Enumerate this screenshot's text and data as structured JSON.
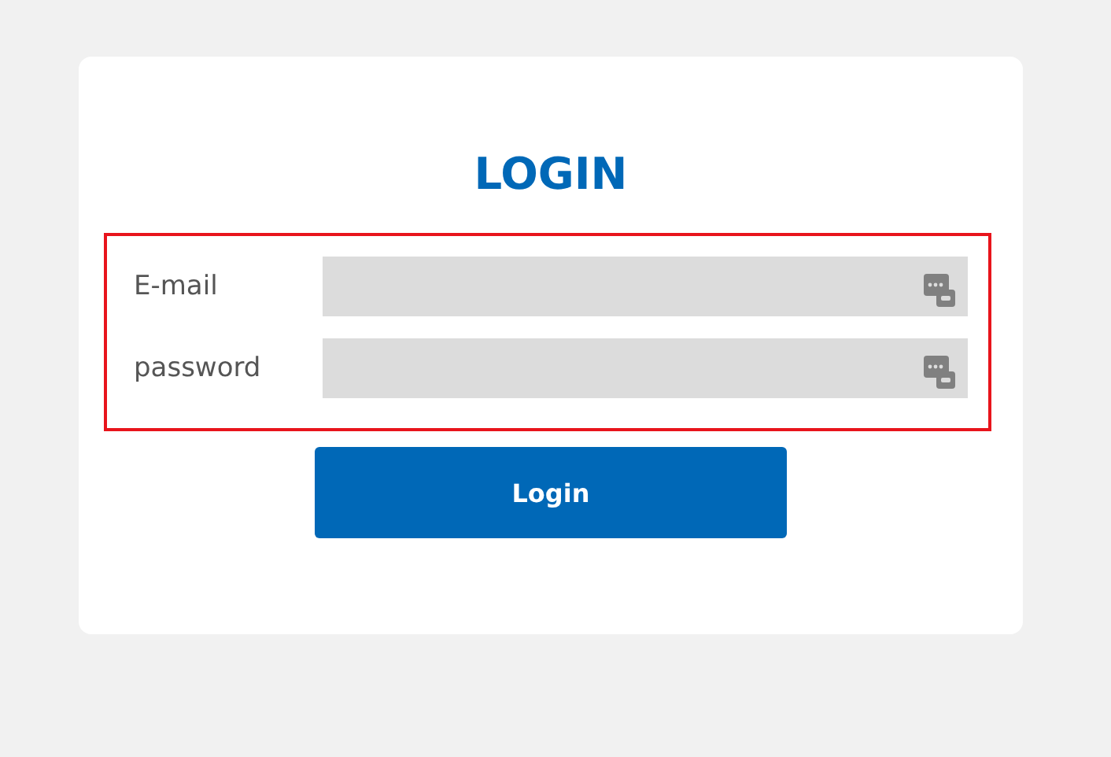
{
  "title": "LOGIN",
  "fields": [
    {
      "label": "E-mail"
    },
    {
      "label": "password"
    }
  ],
  "button": "Login"
}
